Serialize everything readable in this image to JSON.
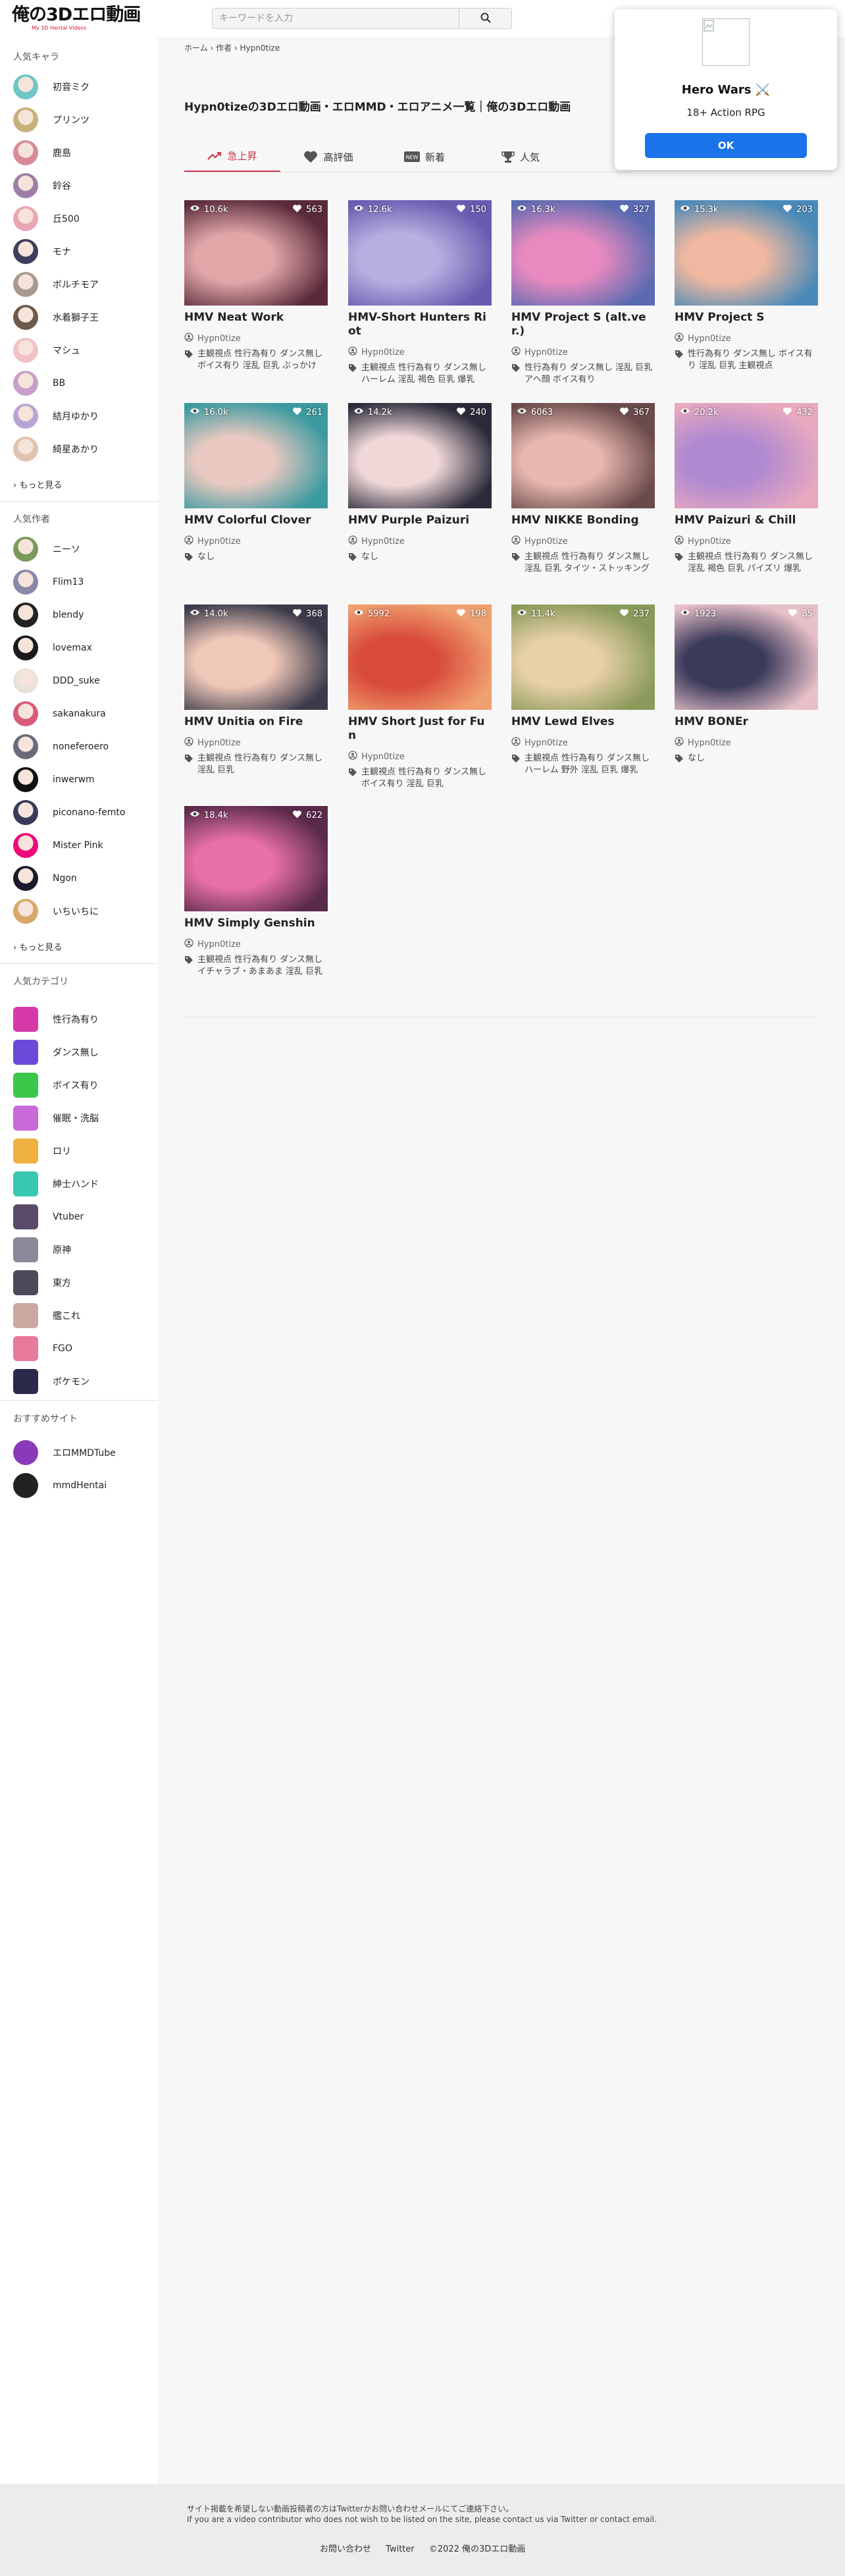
{
  "header": {
    "logo": "俺の3Dエロ動画",
    "logo_sub": "My 3D Hentai Videos",
    "search_placeholder": "キーワードを入力"
  },
  "popup": {
    "title": "Hero Wars ⚔️",
    "subtitle": "18+ Action RPG",
    "ok_label": "OK"
  },
  "sidebar": {
    "popular_chars": {
      "title": "人気キャラ",
      "items": [
        {
          "label": "初音ミク",
          "color": "#6fc5c3"
        },
        {
          "label": "プリンツ",
          "color": "#c8b07a"
        },
        {
          "label": "鹿島",
          "color": "#d98a9a"
        },
        {
          "label": "鈴谷",
          "color": "#9c7ea8"
        },
        {
          "label": "丘500",
          "color": "#e8a6b2"
        },
        {
          "label": "モナ",
          "color": "#3b3f5a"
        },
        {
          "label": "ボルチモア",
          "color": "#a89a8c"
        },
        {
          "label": "水着獅子王",
          "color": "#6e5a4a"
        },
        {
          "label": "マシュ",
          "color": "#f0c2c8"
        },
        {
          "label": "BB",
          "color": "#c6a0c8"
        },
        {
          "label": "結月ゆかり",
          "color": "#b7a4d4"
        },
        {
          "label": "綺星あかり",
          "color": "#e0c3b0"
        }
      ],
      "more": "› もっと見る"
    },
    "popular_authors": {
      "title": "人気作者",
      "items": [
        {
          "label": "ニーソ",
          "color": "#7a9a5a"
        },
        {
          "label": "Flim13",
          "color": "#8888aa"
        },
        {
          "label": "blendy",
          "color": "#222222"
        },
        {
          "label": "lovemax",
          "color": "#1a1a1a"
        },
        {
          "label": "DDD_suke",
          "color": "#e8e2dc"
        },
        {
          "label": "sakanakura",
          "color": "#d85a7a"
        },
        {
          "label": "noneferoero",
          "color": "#6a6a7a"
        },
        {
          "label": "inwerwm",
          "color": "#111111"
        },
        {
          "label": "piconano-femto",
          "color": "#3a3a5a"
        },
        {
          "label": "Mister Pink",
          "color": "#ee0a7a"
        },
        {
          "label": "Ngon",
          "color": "#1a1a2a"
        },
        {
          "label": "いちいちに",
          "color": "#d8a86a"
        }
      ],
      "more": "› もっと見る"
    },
    "popular_categories": {
      "title": "人気カテゴリ",
      "items": [
        {
          "label": "性行為有り",
          "icon": "h-letter-icon",
          "color": "#d63aa8"
        },
        {
          "label": "ダンス無し",
          "icon": "dance-icon",
          "color": "#6a4ad8"
        },
        {
          "label": "ボイス有り",
          "icon": "voice-icon",
          "color": "#3ac84a"
        },
        {
          "label": "催眠・洗脳",
          "icon": "hypno-icon",
          "color": "#c86ad8"
        },
        {
          "label": "ロリ",
          "icon": "loli-icon",
          "color": "#f0b040"
        },
        {
          "label": "紳士ハンド",
          "icon": "hand-icon",
          "color": "#3ac8b0"
        },
        {
          "label": "Vtuber",
          "icon": "vtuber-icon",
          "color": "#5a4a6a"
        },
        {
          "label": "原神",
          "icon": "genshin-icon",
          "color": "#8a8a9a"
        },
        {
          "label": "東方",
          "icon": "touhou-icon",
          "color": "#4a4a5a"
        },
        {
          "label": "艦これ",
          "icon": "kancolle-icon",
          "color": "#c8a8a0"
        },
        {
          "label": "FGO",
          "icon": "fgo-icon",
          "color": "#e87a9a"
        },
        {
          "label": "ポケモン",
          "icon": "pokemon-icon",
          "color": "#2a2a4a"
        }
      ]
    },
    "recommended": {
      "title": "おすすめサイト",
      "items": [
        {
          "label": "エロMMDTube",
          "color": "#8a3ab8"
        },
        {
          "label": "mmdHentai",
          "color": "#222222"
        }
      ]
    }
  },
  "breadcrumb": "ホーム › 作者 › Hypn0tize",
  "page_title": "Hypn0tizeの3Dエロ動画・エロMMD・エロアニメ一覧｜俺の3Dエロ動画",
  "tabs": [
    {
      "label": "急上昇",
      "icon": "trending-up-icon",
      "active": true
    },
    {
      "label": "高評価",
      "icon": "heart-icon",
      "active": false
    },
    {
      "label": "新着",
      "icon": "new-badge-icon",
      "active": false
    },
    {
      "label": "人気",
      "icon": "trophy-icon",
      "active": false
    }
  ],
  "videos": [
    {
      "title": "HMV Neat Work",
      "views": "10.6k",
      "likes": "563",
      "author": "Hypn0tize",
      "tags": "主観視点 性行為有り ダンス無し ボイス有り 淫乱 巨乳 ぶっかけ",
      "c1": "#e0a6a8",
      "c2": "#5a2a3a"
    },
    {
      "title": "HMV-Short Hunters Riot",
      "views": "12.6k",
      "likes": "150",
      "author": "Hypn0tize",
      "tags": "主観視点 性行為有り ダンス無し ハーレム 淫乱 褐色 巨乳 爆乳",
      "c1": "#b8aee0",
      "c2": "#6a5ab0"
    },
    {
      "title": "HMV Project S (alt.ver.)",
      "views": "16.3k",
      "likes": "327",
      "author": "Hypn0tize",
      "tags": "性行為有り ダンス無し 淫乱 巨乳 アヘ顔 ボイス有り",
      "c1": "#e88ac0",
      "c2": "#5a6ab0"
    },
    {
      "title": "HMV Project S",
      "views": "15.3k",
      "likes": "203",
      "author": "Hypn0tize",
      "tags": "性行為有り ダンス無し ボイス有り 淫乱 巨乳 主観視点",
      "c1": "#f0b8a0",
      "c2": "#4a8ab8"
    },
    {
      "title": "HMV Colorful Clover",
      "views": "16.0k",
      "likes": "261",
      "author": "Hypn0tize",
      "tags": "なし",
      "c1": "#e8c8c0",
      "c2": "#3a9aa0"
    },
    {
      "title": "HMV Purple Paizuri",
      "views": "14.2k",
      "likes": "240",
      "author": "Hypn0tize",
      "tags": "なし",
      "c1": "#f0d8d8",
      "c2": "#2a2a3a"
    },
    {
      "title": "HMV NIKKE Bonding",
      "views": "6063",
      "likes": "367",
      "author": "Hypn0tize",
      "tags": "主観視点 性行為有り ダンス無し 淫乱 巨乳 タイツ・ストッキング",
      "c1": "#e8b8b0",
      "c2": "#6a4a4a"
    },
    {
      "title": "HMV Paizuri & Chill",
      "views": "20.2k",
      "likes": "432",
      "author": "Hypn0tize",
      "tags": "主観視点 性行為有り ダンス無し 淫乱 褐色 巨乳 パイズリ 爆乳",
      "c1": "#b08ad0",
      "c2": "#e8a8c0"
    },
    {
      "title": "HMV Unitia on Fire",
      "views": "14.0k",
      "likes": "368",
      "author": "Hypn0tize",
      "tags": "主観視点 性行為有り ダンス無し 淫乱 巨乳",
      "c1": "#f0c8b8",
      "c2": "#3a3a4a"
    },
    {
      "title": "HMV Short Just for Fun",
      "views": "5992",
      "likes": "198",
      "author": "Hypn0tize",
      "tags": "主観視点 性行為有り ダンス無し ボイス有り 淫乱 巨乳",
      "c1": "#d84a3a",
      "c2": "#f0a070"
    },
    {
      "title": "HMV Lewd Elves",
      "views": "11.4k",
      "likes": "237",
      "author": "Hypn0tize",
      "tags": "主観視点 性行為有り ダンス無し ハーレム 野外 淫乱 巨乳 爆乳",
      "c1": "#e8d0a8",
      "c2": "#8a9a5a"
    },
    {
      "title": "HMV BONEr",
      "views": "1923",
      "likes": "85",
      "author": "Hypn0tize",
      "tags": "なし",
      "c1": "#3a3a5a",
      "c2": "#e8c0c8"
    },
    {
      "title": "HMV Simply Genshin",
      "views": "18.4k",
      "likes": "622",
      "author": "Hypn0tize",
      "tags": "主観視点 性行為有り ダンス無し イチャラブ・あまあま 淫乱 巨乳",
      "c1": "#e870a8",
      "c2": "#5a2a4a"
    }
  ],
  "footer": {
    "note_jp": "サイト掲載を希望しない動画投稿者の方はTwitterかお問い合わせメールにてご連絡下さい。",
    "note_en": "If you are a video contributor who does not wish to be listed on the site, please contact us via Twitter or contact email.",
    "contact": "お問い合わせ",
    "twitter": "Twitter",
    "copyright": "©2022 俺の3Dエロ動画"
  }
}
